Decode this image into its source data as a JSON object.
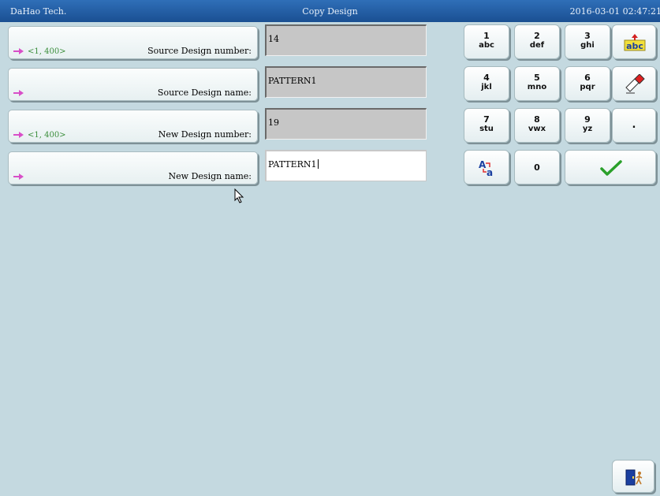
{
  "titlebar": {
    "brand": "DaHao Tech.",
    "title": "Copy Design",
    "datetime": "2016-03-01 02:47:21"
  },
  "fields": [
    {
      "range": "<1, 400>",
      "label": "Source Design number:",
      "value": "14"
    },
    {
      "range": "",
      "label": "Source Design name:",
      "value": "PATTERN1"
    },
    {
      "range": "<1, 400>",
      "label": "New Design number:",
      "value": "19"
    },
    {
      "range": "",
      "label": "New Design name:",
      "value": "PATTERN1"
    }
  ],
  "keypad": {
    "k1": {
      "num": "1",
      "letters": "abc"
    },
    "k2": {
      "num": "2",
      "letters": "def"
    },
    "k3": {
      "num": "3",
      "letters": "ghi"
    },
    "k4": {
      "num": "4",
      "letters": "jkl"
    },
    "k5": {
      "num": "5",
      "letters": "mno"
    },
    "k6": {
      "num": "6",
      "letters": "pqr"
    },
    "k7": {
      "num": "7",
      "letters": "stu"
    },
    "k8": {
      "num": "8",
      "letters": "vwx"
    },
    "k9": {
      "num": "9",
      "letters": "yz"
    },
    "k0": {
      "num": "0"
    },
    "dot": ".",
    "backspace_icon_text": "abc",
    "backspace_icon": "backspace-abc-icon",
    "clear_icon": "eraser-icon",
    "case_icon": "case-toggle-icon",
    "confirm_icon": "checkmark-icon",
    "exit_icon": "exit-door-icon"
  }
}
